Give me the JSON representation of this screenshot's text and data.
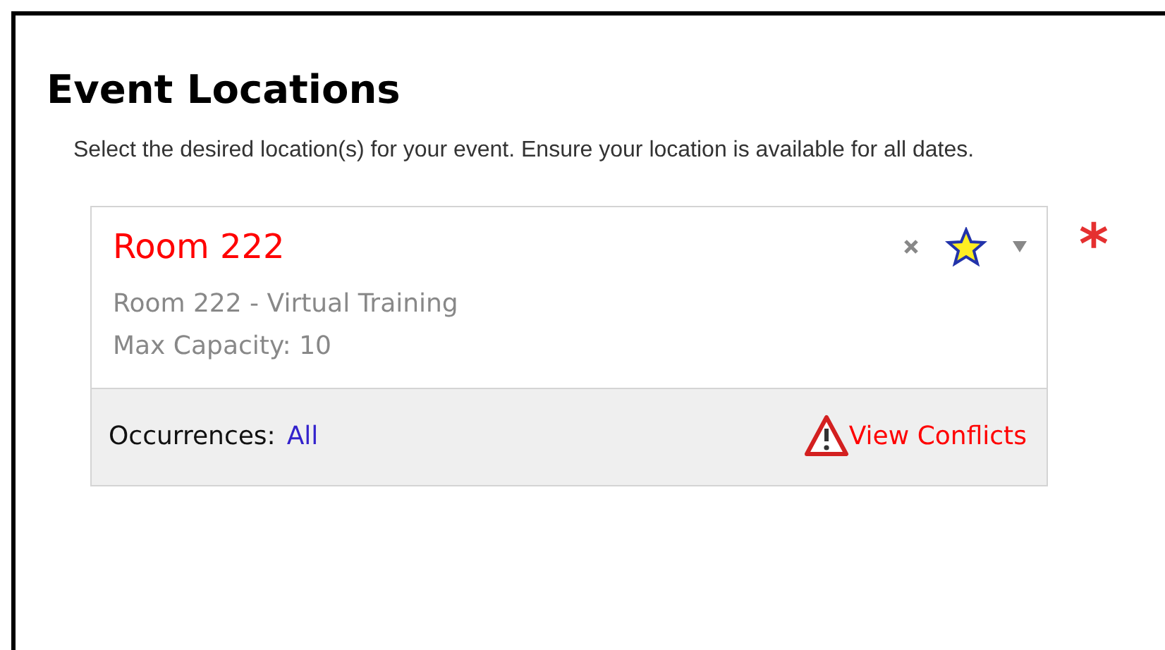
{
  "title": "Event Locations",
  "description": "Select the desired location(s) for your event. Ensure your location is available for all dates.",
  "location": {
    "name": "Room 222",
    "details": [
      "Room 222 - Virtual Training",
      "Max Capacity: 10"
    ],
    "favorite": true,
    "occurrences_label": "Occurrences:",
    "occurrences_value": "All",
    "conflicts_link": "View Conflicts"
  },
  "required_mark": "*"
}
